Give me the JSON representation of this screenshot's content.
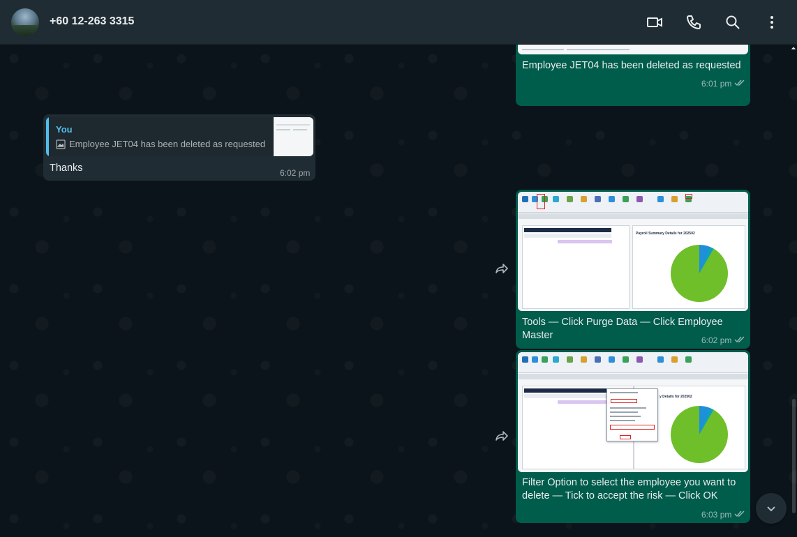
{
  "header": {
    "contact_name": "+60 12-263 3315",
    "icons": [
      "video-call-icon",
      "voice-call-icon",
      "search-icon",
      "more-menu-icon"
    ]
  },
  "messages": [
    {
      "type": "outgoing-image",
      "caption": "Employee JET04 has been deleted as requested",
      "time": "6:01 pm"
    },
    {
      "type": "incoming-reply",
      "quote_author": "You",
      "quote_text": "Employee JET04 has been deleted as requested",
      "text": "Thanks",
      "time": "6:02 pm"
    },
    {
      "type": "outgoing-image",
      "caption": "Tools — Click Purge Data — Click Employee Master",
      "time": "6:02 pm",
      "screenshot_title": "Payroll Summary Details for 202502"
    },
    {
      "type": "outgoing-image",
      "caption_line1": "Filter Option to select the employee you want to",
      "caption_line2": "delete — Tick to accept the risk — Click OK",
      "time": "6:03 pm",
      "screenshot_title": "y Details for 202502"
    }
  ],
  "colors": {
    "header_bg": "#202c33",
    "outgoing_bubble": "#005c4b",
    "incoming_bubble": "#202c33",
    "quote_accent": "#53bdeb",
    "icon_color": "#aebac1"
  }
}
